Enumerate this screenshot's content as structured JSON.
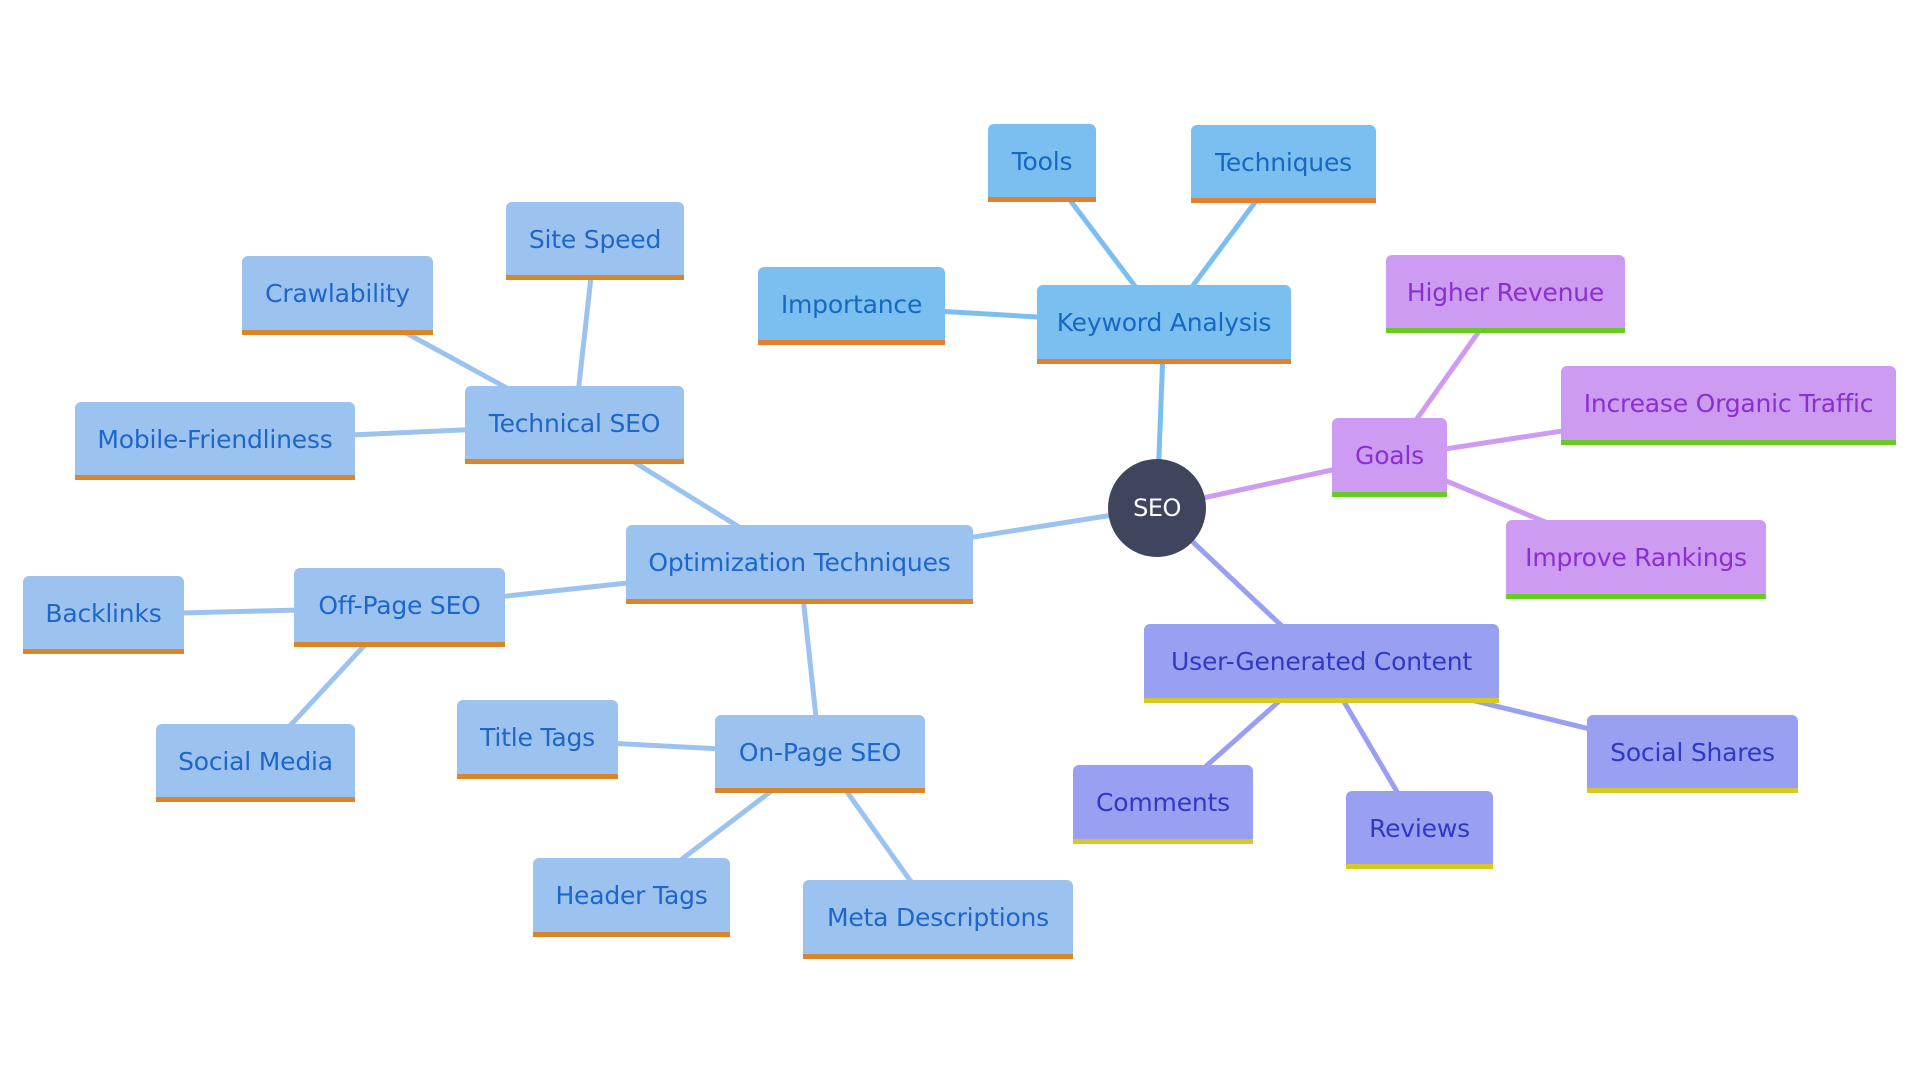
{
  "diagram": {
    "type": "mindmap",
    "root": {
      "id": "seo",
      "label": "SEO",
      "color": "#40455e"
    },
    "groups": {
      "kw": {
        "fill": "#7bbff1",
        "text": "#1768c0",
        "accent": "#e57f2e",
        "edge": "#7bbff1"
      },
      "opt": {
        "fill": "#9cc3ef",
        "text": "#1f66c9",
        "accent": "#d98628",
        "edge": "#9cc3ef"
      },
      "goal": {
        "fill": "#cd9bf1",
        "text": "#8a2fd0",
        "accent": "#66cc24",
        "edge": "#cd9bf1"
      },
      "ugc": {
        "fill": "#9aa0f1",
        "text": "#3038c4",
        "accent": "#d6c923",
        "edge": "#9aa0f1"
      }
    },
    "nodes": [
      {
        "id": "keyword-analysis",
        "label": "Keyword Analysis",
        "group": "kw",
        "parent": "seo"
      },
      {
        "id": "tools",
        "label": "Tools",
        "group": "kw",
        "parent": "keyword-analysis"
      },
      {
        "id": "techniques",
        "label": "Techniques",
        "group": "kw",
        "parent": "keyword-analysis"
      },
      {
        "id": "importance",
        "label": "Importance",
        "group": "kw",
        "parent": "keyword-analysis"
      },
      {
        "id": "goals",
        "label": "Goals",
        "group": "goal",
        "parent": "seo"
      },
      {
        "id": "higher-revenue",
        "label": "Higher Revenue",
        "group": "goal",
        "parent": "goals"
      },
      {
        "id": "increase-organic-traffic",
        "label": "Increase Organic Traffic",
        "group": "goal",
        "parent": "goals"
      },
      {
        "id": "improve-rankings",
        "label": "Improve Rankings",
        "group": "goal",
        "parent": "goals"
      },
      {
        "id": "user-generated-content",
        "label": "User-Generated Content",
        "group": "ugc",
        "parent": "seo"
      },
      {
        "id": "comments",
        "label": "Comments",
        "group": "ugc",
        "parent": "user-generated-content"
      },
      {
        "id": "reviews",
        "label": "Reviews",
        "group": "ugc",
        "parent": "user-generated-content"
      },
      {
        "id": "social-shares",
        "label": "Social Shares",
        "group": "ugc",
        "parent": "user-generated-content"
      },
      {
        "id": "optimization-techniques",
        "label": "Optimization Techniques",
        "group": "opt",
        "parent": "seo"
      },
      {
        "id": "technical-seo",
        "label": "Technical SEO",
        "group": "opt",
        "parent": "optimization-techniques"
      },
      {
        "id": "site-speed",
        "label": "Site Speed",
        "group": "opt",
        "parent": "technical-seo"
      },
      {
        "id": "crawlability",
        "label": "Crawlability",
        "group": "opt",
        "parent": "technical-seo"
      },
      {
        "id": "mobile-friendliness",
        "label": "Mobile-Friendliness",
        "group": "opt",
        "parent": "technical-seo"
      },
      {
        "id": "off-page-seo",
        "label": "Off-Page SEO",
        "group": "opt",
        "parent": "optimization-techniques"
      },
      {
        "id": "backlinks",
        "label": "Backlinks",
        "group": "opt",
        "parent": "off-page-seo"
      },
      {
        "id": "social-media",
        "label": "Social Media",
        "group": "opt",
        "parent": "off-page-seo"
      },
      {
        "id": "on-page-seo",
        "label": "On-Page SEO",
        "group": "opt",
        "parent": "optimization-techniques"
      },
      {
        "id": "title-tags",
        "label": "Title Tags",
        "group": "opt",
        "parent": "on-page-seo"
      },
      {
        "id": "header-tags",
        "label": "Header Tags",
        "group": "opt",
        "parent": "on-page-seo"
      },
      {
        "id": "meta-descriptions",
        "label": "Meta Descriptions",
        "group": "opt",
        "parent": "on-page-seo"
      }
    ]
  }
}
